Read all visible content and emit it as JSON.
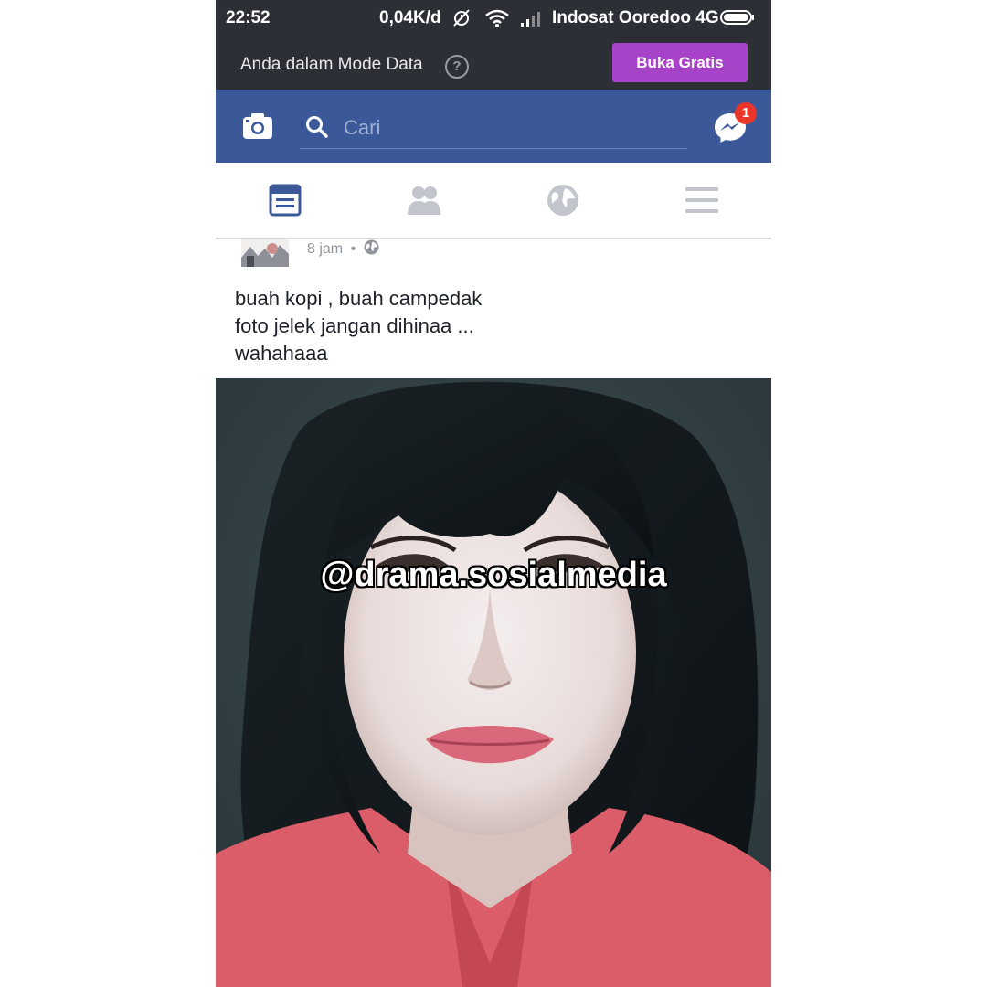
{
  "status_bar": {
    "time": "22:52",
    "speed": "0,04K/d",
    "carrier": "Indosat Ooredoo 4G",
    "icons": [
      "alarm-off-icon",
      "wifi-icon",
      "signal-icon",
      "battery-icon"
    ]
  },
  "mode_banner": {
    "text": "Anda dalam Mode Data",
    "help_glyph": "?",
    "button_label": "Buka Gratis",
    "button_color": "#a643c9"
  },
  "header": {
    "search_placeholder": "Cari",
    "messenger_badge": "1",
    "brand_color": "#3b5998",
    "icons": [
      "camera-icon",
      "search-icon",
      "messenger-icon"
    ]
  },
  "tabs": [
    {
      "name": "news-feed",
      "icon": "news-feed-icon",
      "active": true
    },
    {
      "name": "friends",
      "icon": "friends-icon",
      "active": false
    },
    {
      "name": "notifications",
      "icon": "globe-icon",
      "active": false
    },
    {
      "name": "menu",
      "icon": "menu-icon",
      "active": false
    }
  ],
  "post": {
    "time": "8 jam",
    "separator": "•",
    "privacy_icon": "public-globe-icon",
    "lines": [
      "buah kopi , buah campedak",
      "foto jelek jangan dihinaa ...",
      "wahahaaa"
    ]
  },
  "photo": {
    "watermark": "@drama.sosialmedia"
  }
}
